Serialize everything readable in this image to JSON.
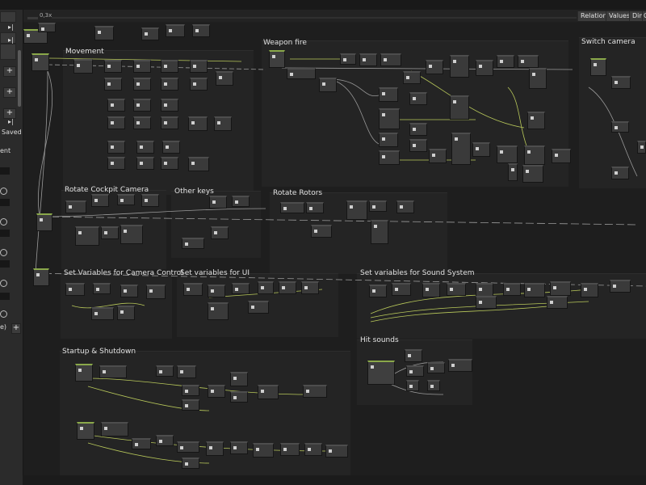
{
  "toolbar": {
    "zoom": "0,3x",
    "buttons": [
      "Relations",
      "Values",
      "Dim",
      "G"
    ]
  },
  "left_panel": {
    "saved_label": "Saved",
    "section_label": "ent",
    "bottom_label": "e)"
  },
  "groups": [
    {
      "title": "Movement"
    },
    {
      "title": "Weapon fire"
    },
    {
      "title": "Switch camera"
    },
    {
      "title": "Rotate Cockpit Camera"
    },
    {
      "title": "Other keys"
    },
    {
      "title": "Rotate Rotors"
    },
    {
      "title": "Set Variables for Camera Control"
    },
    {
      "title": "Set variables for UI"
    },
    {
      "title": "Set variables for Sound System"
    },
    {
      "title": "Hit sounds"
    },
    {
      "title": "Startup & Shutdown"
    }
  ]
}
